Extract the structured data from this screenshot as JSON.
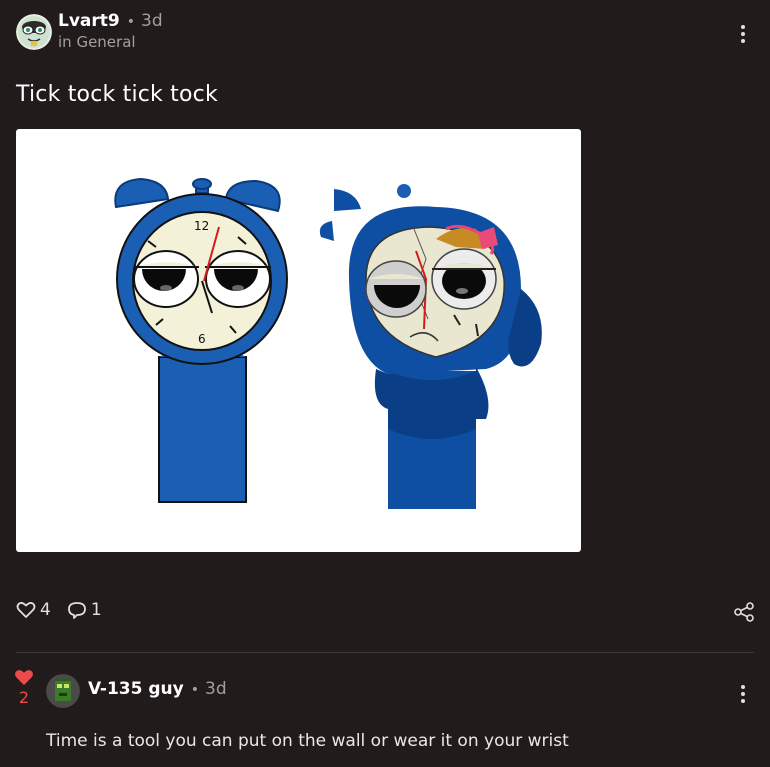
{
  "post": {
    "author": "Lvart9",
    "separator": "•",
    "time": "3d",
    "community": "in General",
    "title": "Tick tock tick tock",
    "likes": "4",
    "comments": "1"
  },
  "comment": {
    "likes": "2",
    "author": "V-135 guy",
    "separator": "•",
    "time": "3d",
    "text": "Time is a tool you can put on the wall or wear it on your wrist"
  },
  "colors": {
    "background": "#221b1c",
    "muted_text": "#a59d9e",
    "like_red": "#ef4a4a",
    "clock_blue": "#1a5fb4"
  },
  "icons": {
    "post_menu": "more-vertical-icon",
    "like": "heart-outline-icon",
    "comment": "speech-bubble-icon",
    "share": "share-icon",
    "comment_liked": "heart-filled-icon",
    "comment_menu": "more-vertical-icon"
  }
}
